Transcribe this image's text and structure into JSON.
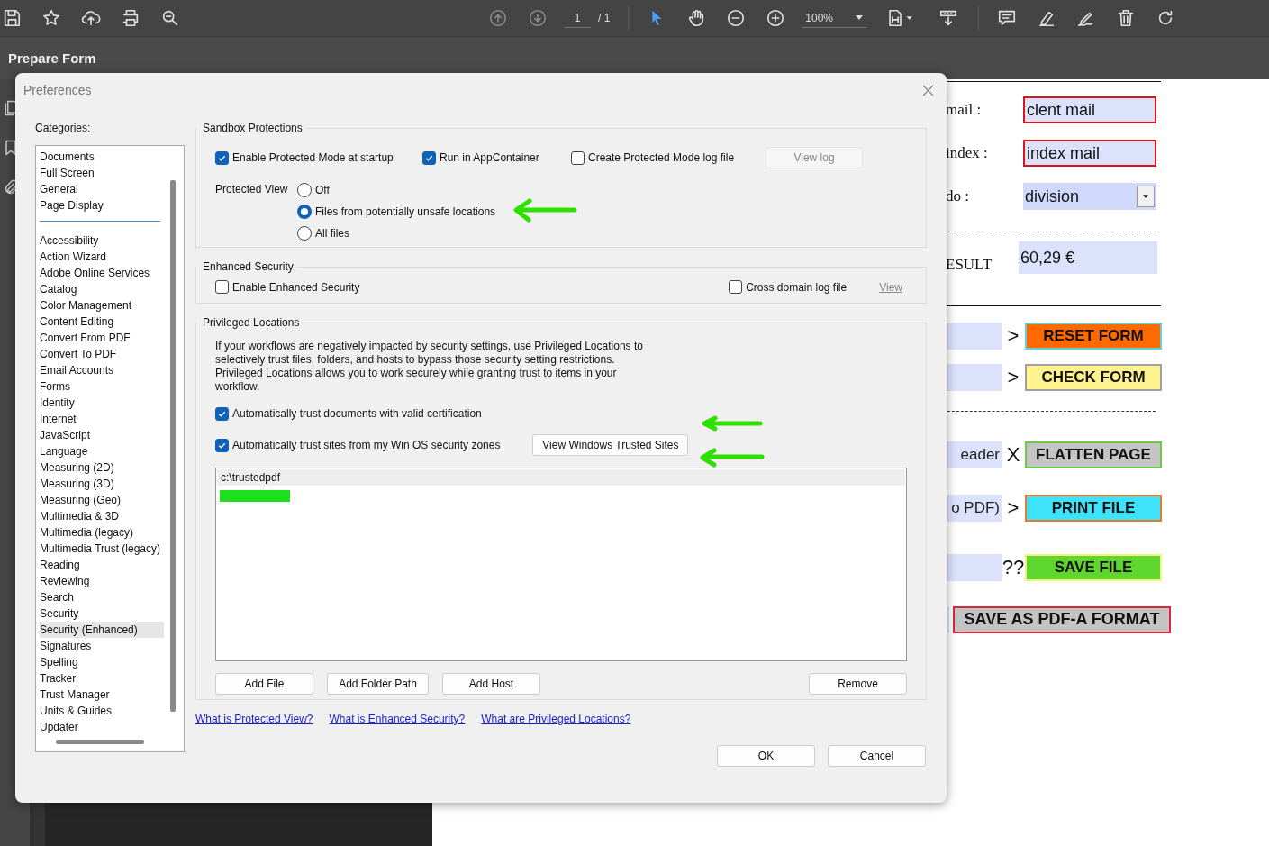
{
  "toolbar": {
    "page_number": "1",
    "page_total": "/ 1",
    "zoom": "100%"
  },
  "tool_title": "Prepare Form",
  "dialog": {
    "title": "Preferences",
    "categories_label": "Categories:",
    "category_groups": [
      [
        {
          "label": "Documents",
          "selected": false
        },
        {
          "label": "Full Screen",
          "selected": false
        },
        {
          "label": "General",
          "selected": false
        },
        {
          "label": "Page Display",
          "selected": false
        }
      ],
      [
        {
          "label": "Accessibility",
          "selected": false
        },
        {
          "label": "Action Wizard",
          "selected": false
        },
        {
          "label": "Adobe Online Services",
          "selected": false
        },
        {
          "label": "Catalog",
          "selected": false
        },
        {
          "label": "Color Management",
          "selected": false
        },
        {
          "label": "Content Editing",
          "selected": false
        },
        {
          "label": "Convert From PDF",
          "selected": false
        },
        {
          "label": "Convert To PDF",
          "selected": false
        },
        {
          "label": "Email Accounts",
          "selected": false
        },
        {
          "label": "Forms",
          "selected": false
        },
        {
          "label": "Identity",
          "selected": false
        },
        {
          "label": "Internet",
          "selected": false
        },
        {
          "label": "JavaScript",
          "selected": false
        },
        {
          "label": "Language",
          "selected": false
        },
        {
          "label": "Measuring (2D)",
          "selected": false
        },
        {
          "label": "Measuring (3D)",
          "selected": false
        },
        {
          "label": "Measuring (Geo)",
          "selected": false
        },
        {
          "label": "Multimedia & 3D",
          "selected": false
        },
        {
          "label": "Multimedia (legacy)",
          "selected": false
        },
        {
          "label": "Multimedia Trust (legacy)",
          "selected": false
        },
        {
          "label": "Reading",
          "selected": false
        },
        {
          "label": "Reviewing",
          "selected": false
        },
        {
          "label": "Search",
          "selected": false
        },
        {
          "label": "Security",
          "selected": false
        },
        {
          "label": "Security (Enhanced)",
          "selected": true
        },
        {
          "label": "Signatures",
          "selected": false
        },
        {
          "label": "Spelling",
          "selected": false
        },
        {
          "label": "Tracker",
          "selected": false
        },
        {
          "label": "Trust Manager",
          "selected": false
        },
        {
          "label": "Units & Guides",
          "selected": false
        },
        {
          "label": "Updater",
          "selected": false
        }
      ]
    ],
    "sandbox": {
      "title": "Sandbox Protections",
      "checkboxes": [
        {
          "label": "Enable Protected Mode at startup",
          "checked": true
        },
        {
          "label": "Run in AppContainer",
          "checked": true
        },
        {
          "label": "Create Protected Mode log file",
          "checked": false
        }
      ],
      "view_log": {
        "label": "View log",
        "disabled": true
      },
      "protected_view": {
        "label": "Protected View",
        "options": [
          {
            "label": "Off",
            "selected": false
          },
          {
            "label": "Files from potentially unsafe locations",
            "selected": true
          },
          {
            "label": "All files",
            "selected": false
          }
        ]
      }
    },
    "enhanced": {
      "title": "Enhanced Security",
      "checkbox": {
        "label": "Enable Enhanced Security",
        "checked": false
      },
      "cross_domain": {
        "label": "Cross domain log file",
        "checked": false
      },
      "view_link": {
        "label": "View",
        "disabled": true
      }
    },
    "privileged": {
      "title": "Privileged Locations",
      "description": "If your workflows are negatively impacted by security settings, use Privileged Locations to selectively trust files, folders, and hosts to bypass those security setting restrictions. Privileged Locations allows you to work securely while granting trust to items in your workflow.",
      "checkboxes": [
        {
          "label": "Automatically trust documents with valid certification",
          "checked": true
        },
        {
          "label": "Automatically trust sites from my Win OS security zones",
          "checked": true
        }
      ],
      "trusted_sites_button": "View Windows Trusted Sites",
      "locations": [
        {
          "path": "c:\\trustedpdf",
          "selected": true
        }
      ],
      "buttons": [
        "Add File",
        "Add Folder Path",
        "Add Host"
      ],
      "remove_button": "Remove"
    },
    "links": [
      "What is Protected View?",
      "What is Enhanced Security?",
      "What are Privileged Locations?"
    ],
    "buttons": [
      "OK",
      "Cancel"
    ]
  },
  "document": {
    "rows": [
      {
        "kind": "rule"
      },
      {
        "kind": "field",
        "label": "mail :",
        "value": "clent mail"
      },
      {
        "kind": "field",
        "label": "index :",
        "value": "index mail"
      },
      {
        "kind": "dropdown",
        "label": "do :",
        "value": "division"
      },
      {
        "kind": "dashed_rule"
      },
      {
        "kind": "result",
        "label": "ESULT",
        "value": "60,29 €"
      },
      {
        "kind": "rule"
      },
      {
        "kind": "action",
        "sign": ">",
        "button": "RESET FORM",
        "color": "#ff6a00"
      },
      {
        "kind": "action",
        "sign": ">",
        "button": "CHECK FORM",
        "color": "#fdf28e"
      },
      {
        "kind": "dashed_rule"
      },
      {
        "kind": "action",
        "field_text": "eader",
        "sign": "X",
        "button": "FLATTEN PAGE",
        "color": "#c4c4c4"
      },
      {
        "kind": "action",
        "field_text": "o PDF)",
        "sign": ">",
        "button": "PRINT FILE",
        "color": "#3ee3fb"
      },
      {
        "kind": "action",
        "sign": "??",
        "button": "SAVE FILE",
        "color": "#5fd62e"
      },
      {
        "kind": "wide_action",
        "button": "SAVE AS PDF-A FORMAT",
        "color": "#c4c4c4"
      }
    ]
  }
}
